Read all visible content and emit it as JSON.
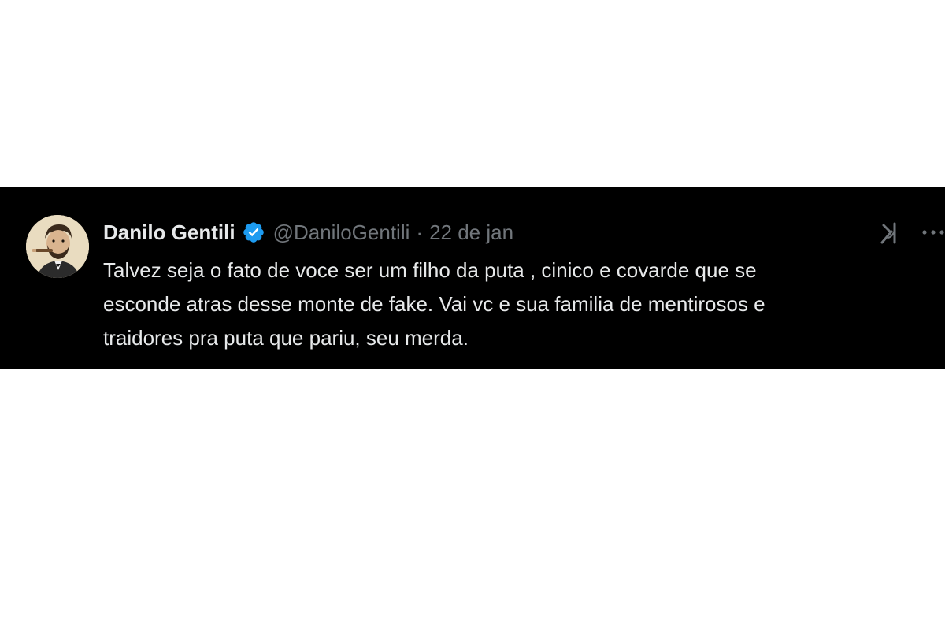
{
  "tweet": {
    "author": {
      "display_name": "Danilo Gentili",
      "handle": "@DaniloGentili",
      "verified": true,
      "avatar": "avatar-illustration"
    },
    "separator": "·",
    "date": "22 de jan",
    "text": "Talvez seja o fato de voce ser um filho da puta , cinico e covarde que se\nesconde atras desse monte de fake. Vai vc e sua familia  de mentirosos e\ntraidores pra puta que pariu, seu merda.",
    "icons": {
      "grok": "grok-icon",
      "more": "more-options-icon",
      "verified": "verified-badge-icon"
    }
  },
  "colors": {
    "background": "#000000",
    "page_background": "#ffffff",
    "primary_text": "#e7e9ea",
    "secondary_text": "#71767b",
    "verified_blue": "#1d9bf0"
  }
}
